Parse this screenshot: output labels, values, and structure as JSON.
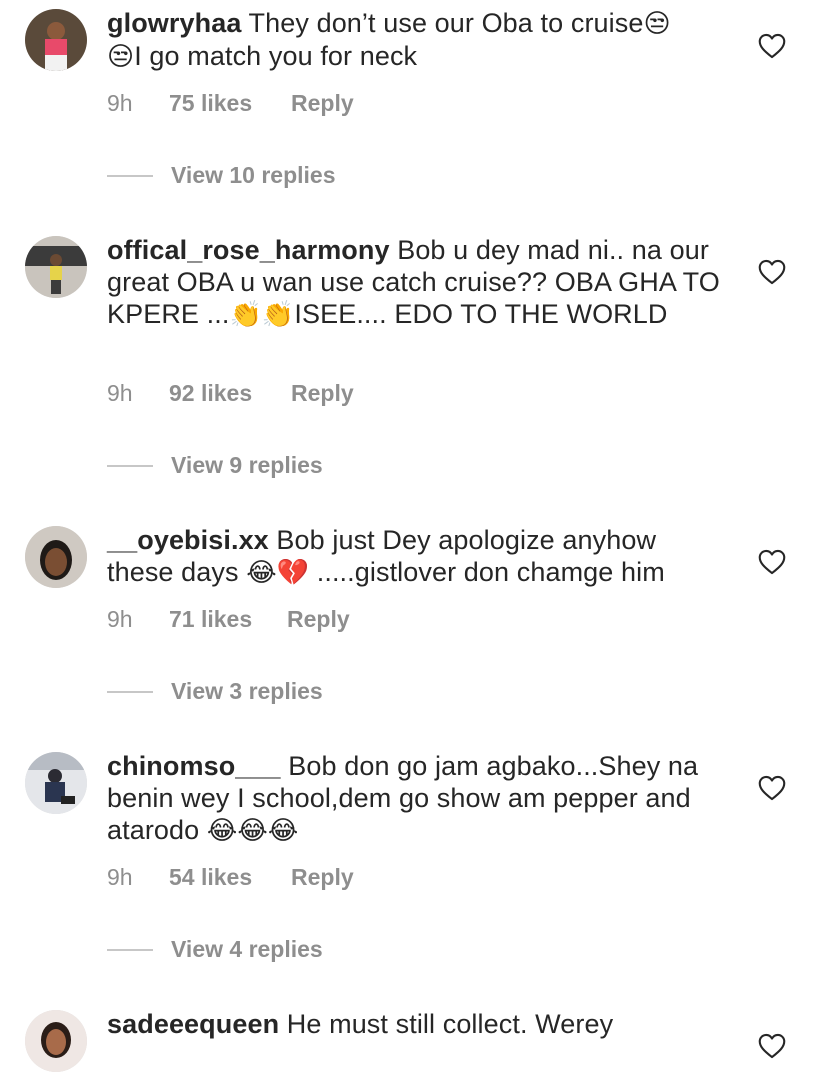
{
  "comments": [
    {
      "username": "glowryhaa",
      "text_before": " They don’t use our Oba to cruise",
      "emoji1": "😒",
      "line2_emoji": "😒",
      "text_after": "I go match you for neck",
      "time": "9h",
      "likes": "75 likes",
      "reply": "Reply",
      "view_replies": "View 10 replies"
    },
    {
      "username": "offical_rose_harmony",
      "text_a": " Bob u dey mad ni.. na our great OBA  u wan use catch cruise?? OBA GHA TO KPERE ...",
      "emoji": "👏👏",
      "text_b": "ISEE.... EDO TO THE WORLD",
      "time": "9h",
      "likes": "92 likes",
      "reply": "Reply",
      "view_replies": "View 9 replies"
    },
    {
      "username": "__oyebisi.xx",
      "text_a": " Bob just Dey apologize anyhow these days ",
      "emoji": "😂💔",
      "text_b": " .....gistlover don chamge him",
      "time": "9h",
      "likes": "71 likes",
      "reply": "Reply",
      "view_replies": "View 3 replies"
    },
    {
      "username": "chinomso___",
      "text_a": " Bob don go jam agbako...Shey na benin wey I school,dem go show am pepper and atarodo ",
      "emoji": "😂😂😂",
      "time": "9h",
      "likes": "54 likes",
      "reply": "Reply",
      "view_replies": "View 4 replies"
    },
    {
      "username": "sadeeequeen",
      "text_a": " He must still collect. Werey"
    }
  ],
  "colors": {
    "text": "#262626",
    "secondary": "#8e8e8e",
    "divider": "#c7c7c7"
  },
  "icons": {
    "like": "heart-outline-icon"
  }
}
